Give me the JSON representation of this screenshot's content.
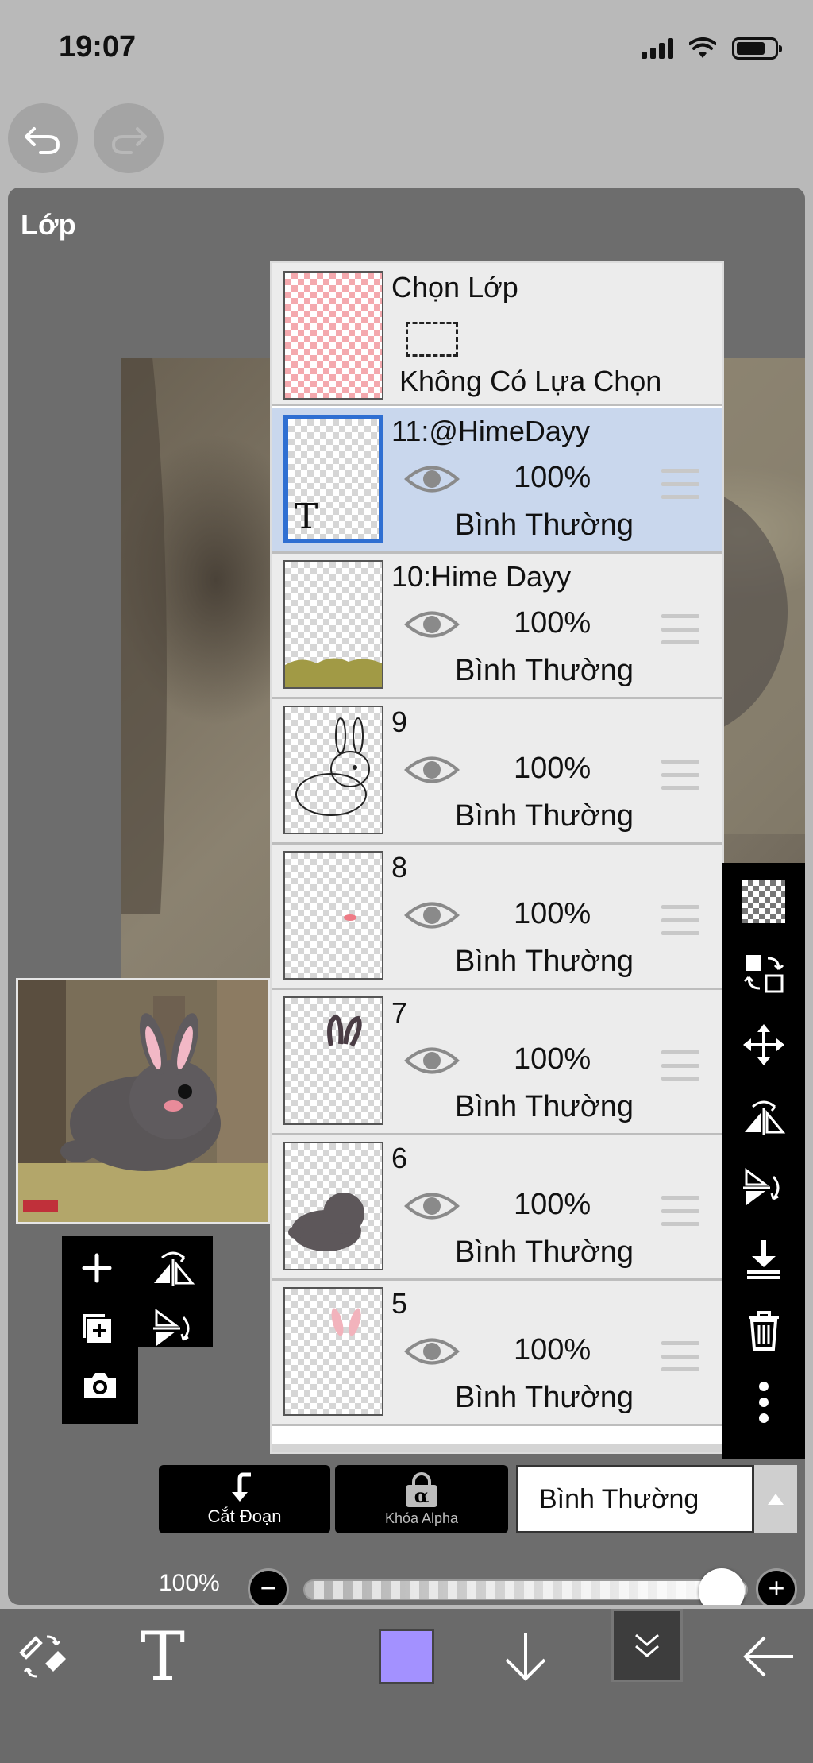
{
  "status_bar": {
    "time": "19:07"
  },
  "panel": {
    "title": "Lớp"
  },
  "selection_row": {
    "title": "Chọn Lớp",
    "subtitle": "Không Có Lựa Chọn"
  },
  "layers": [
    {
      "name": "11:@HimeDayy",
      "opacity": "100%",
      "blend": "Bình Thường",
      "selected": true,
      "text_glyph": "T",
      "thumb": "text-layer"
    },
    {
      "name": "10:Hime Dayy",
      "opacity": "100%",
      "blend": "Bình Thường",
      "selected": false,
      "thumb": "grass"
    },
    {
      "name": "9",
      "opacity": "100%",
      "blend": "Bình Thường",
      "selected": false,
      "thumb": "bunny-lineart"
    },
    {
      "name": "8",
      "opacity": "100%",
      "blend": "Bình Thường",
      "selected": false,
      "thumb": "blush-dot"
    },
    {
      "name": "7",
      "opacity": "100%",
      "blend": "Bình Thường",
      "selected": false,
      "thumb": "ears-outline"
    },
    {
      "name": "6",
      "opacity": "100%",
      "blend": "Bình Thường",
      "selected": false,
      "thumb": "bunny-silhouette"
    },
    {
      "name": "5",
      "opacity": "100%",
      "blend": "Bình Thường",
      "selected": false,
      "thumb": "pink-ears"
    }
  ],
  "controls": {
    "clipping_label": "Cắt Đoạn",
    "alpha_lock_label": "Khóa Alpha",
    "alpha_glyph": "α",
    "blend_mode": "Bình Thường",
    "opacity_label": "100%",
    "opacity_value": 1.0,
    "minus": "−",
    "plus": "+"
  },
  "colors": {
    "accent": "#2f6fd2",
    "current_color": "#a391ff",
    "selected_row": "#c9d7ed"
  },
  "bottom_toolbar": {
    "text_tool_glyph": "T"
  },
  "icons": [
    "undo-icon",
    "redo-icon",
    "eye-icon",
    "drag-handle-icon",
    "add-layer-icon",
    "duplicate-layer-icon",
    "camera-icon",
    "flip-horizontal-icon",
    "flip-vertical-icon",
    "checker-icon",
    "transfer-icon",
    "move-icon",
    "merge-down-icon",
    "trash-icon",
    "more-icon",
    "brush-eraser-icon",
    "arrow-down-icon",
    "chevron-double-down-icon",
    "back-arrow-icon"
  ]
}
